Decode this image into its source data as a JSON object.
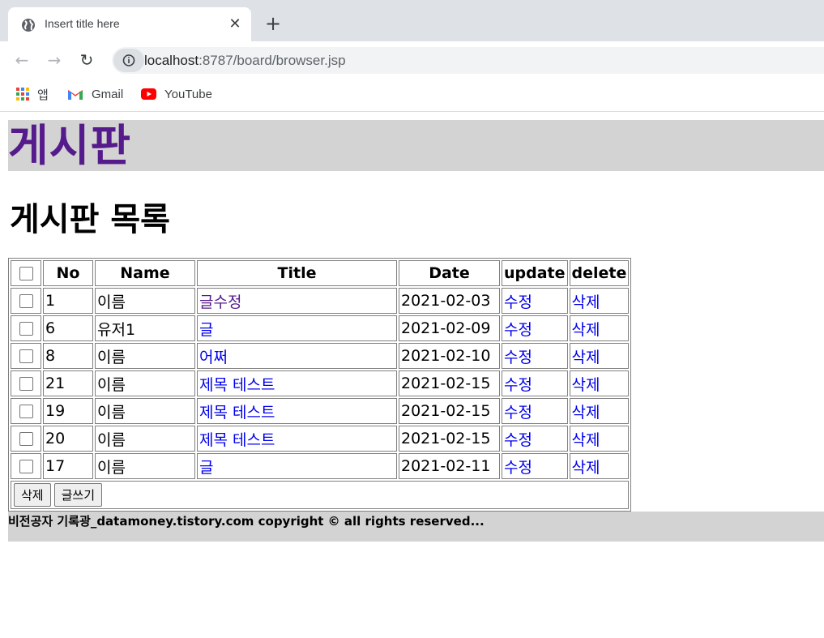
{
  "browser": {
    "tab_title": "Insert title here",
    "url_host": "localhost",
    "url_path": ":8787/board/browser.jsp",
    "bookmarks": [
      {
        "label": "앱",
        "icon": "apps-grid-icon"
      },
      {
        "label": "Gmail",
        "icon": "gmail-icon"
      },
      {
        "label": "YouTube",
        "icon": "youtube-icon"
      }
    ]
  },
  "page": {
    "header_title": "게시판",
    "list_title": "게시판 목록",
    "columns": [
      "No",
      "Name",
      "Title",
      "Date",
      "update",
      "delete"
    ],
    "rows": [
      {
        "no": "1",
        "name": "이름",
        "title": "글수정",
        "date": "2021-02-03",
        "update": "수정",
        "delete": "삭제"
      },
      {
        "no": "6",
        "name": "유저1",
        "title": "글",
        "date": "2021-02-09",
        "update": "수정",
        "delete": "삭제"
      },
      {
        "no": "8",
        "name": "이름",
        "title": "어쩌",
        "date": "2021-02-10",
        "update": "수정",
        "delete": "삭제"
      },
      {
        "no": "21",
        "name": "이름",
        "title": "제목 테스트",
        "date": "2021-02-15",
        "update": "수정",
        "delete": "삭제"
      },
      {
        "no": "19",
        "name": "이름",
        "title": "제목 테스트",
        "date": "2021-02-15",
        "update": "수정",
        "delete": "삭제"
      },
      {
        "no": "20",
        "name": "이름",
        "title": "제목 테스트",
        "date": "2021-02-15",
        "update": "수정",
        "delete": "삭제"
      },
      {
        "no": "17",
        "name": "이름",
        "title": "글",
        "date": "2021-02-11",
        "update": "수정",
        "delete": "삭제"
      }
    ],
    "delete_button": "삭제",
    "write_button": "글쓰기",
    "footer": "비전공자 기록광_datamoney.tistory.com copyright © all rights reserved..."
  },
  "colors": {
    "link": "#0000ee",
    "visited_link": "#551a8b",
    "header_bg": "#d3d3d3"
  }
}
